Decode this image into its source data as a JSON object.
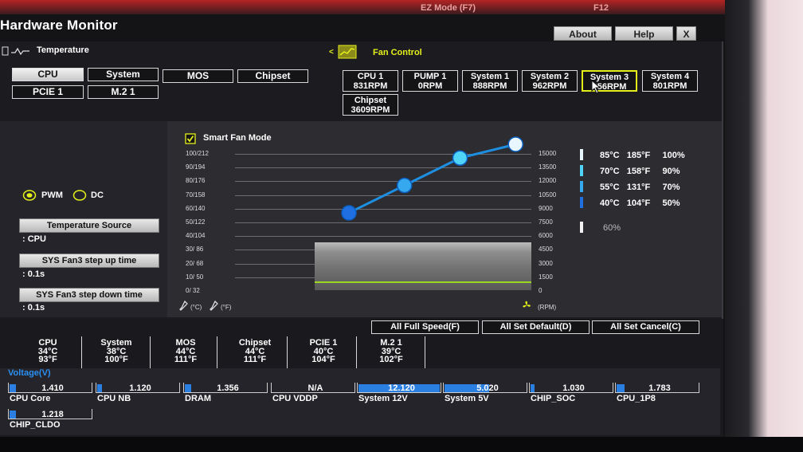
{
  "window": {
    "title": "Hardware Monitor",
    "top_buttons": {
      "about": "About",
      "help": "Help",
      "close": "X"
    }
  },
  "topbar": {
    "mode": "EZ Mode (F7)",
    "f12": "F12"
  },
  "tabs": {
    "temperature": "Temperature",
    "fan_control": "< Fan Control"
  },
  "temp_sources": [
    "CPU",
    "System",
    "MOS",
    "Chipset",
    "PCIE 1",
    "M.2 1"
  ],
  "fans": [
    {
      "name": "CPU 1",
      "rpm": "831RPM"
    },
    {
      "name": "PUMP 1",
      "rpm": "0RPM"
    },
    {
      "name": "System 1",
      "rpm": "888RPM"
    },
    {
      "name": "System 2",
      "rpm": "962RPM"
    },
    {
      "name": "System 3",
      "rpm": "856RPM"
    },
    {
      "name": "System 4",
      "rpm": "801RPM"
    },
    {
      "name": "Chipset",
      "rpm": "3609RPM"
    }
  ],
  "selected_fan": "System 3",
  "control": {
    "pwm": "PWM",
    "dc": "DC",
    "mode_selected": "PWM",
    "temp_source_label": "Temperature Source",
    "temp_source_value": ": CPU",
    "step_up_label": "SYS Fan3 step up time",
    "step_up_value": ": 0.1s",
    "step_down_label": "SYS Fan3 step down time",
    "step_down_value": ": 0.1s"
  },
  "graph": {
    "smart_fan_label": "Smart Fan Mode",
    "smart_fan_checked": true,
    "left_ticks": [
      "100/212",
      "90/194",
      "80/176",
      "70/158",
      "60/140",
      "50/122",
      "40/104",
      "30/ 86",
      "20/ 68",
      "10/ 50",
      "0/ 32"
    ],
    "right_ticks": [
      "15000",
      "13500",
      "12000",
      "10500",
      "9000",
      "7500",
      "6000",
      "4500",
      "3000",
      "1500",
      "0"
    ],
    "unit_left": "(°C)",
    "unit_f": "(°F)",
    "unit_right": "(RPM)",
    "curve_points": [
      {
        "temp_c": 40,
        "pct": 50
      },
      {
        "temp_c": 55,
        "pct": 70
      },
      {
        "temp_c": 70,
        "pct": 90
      },
      {
        "temp_c": 85,
        "pct": 100
      }
    ],
    "current_level": 0.35
  },
  "legend": [
    {
      "c": "85°C",
      "f": "185°F",
      "pct": "100%",
      "color": "#e8f6ff"
    },
    {
      "c": "70°C",
      "f": "158°F",
      "pct": "90%",
      "color": "#4fd3f7"
    },
    {
      "c": "55°C",
      "f": "131°F",
      "pct": "70%",
      "color": "#35a8ee"
    },
    {
      "c": "40°C",
      "f": "104°F",
      "pct": "50%",
      "color": "#1f6fe0"
    }
  ],
  "current_pct": "60%",
  "actions": {
    "full_speed": "All Full Speed(F)",
    "set_default": "All Set Default(D)",
    "set_cancel": "All Set Cancel(C)"
  },
  "temps": [
    {
      "name": "CPU",
      "c": "34°C",
      "f": "93°F"
    },
    {
      "name": "System",
      "c": "38°C",
      "f": "100°F"
    },
    {
      "name": "MOS",
      "c": "44°C",
      "f": "111°F"
    },
    {
      "name": "Chipset",
      "c": "44°C",
      "f": "111°F"
    },
    {
      "name": "PCIE 1",
      "c": "40°C",
      "f": "104°F"
    },
    {
      "name": "M.2 1",
      "c": "39°C",
      "f": "102°F"
    }
  ],
  "voltage_title": "Voltage(V)",
  "voltages": [
    {
      "name": "CPU Core",
      "value": "1.410",
      "fill": 0.08
    },
    {
      "name": "CPU NB",
      "value": "1.120",
      "fill": 0.06
    },
    {
      "name": "DRAM",
      "value": "1.356",
      "fill": 0.08
    },
    {
      "name": "CPU VDDP",
      "value": "N/A",
      "fill": 0
    },
    {
      "name": "System 12V",
      "value": "12.120",
      "fill": 1.0
    },
    {
      "name": "System 5V",
      "value": "5.020",
      "fill": 0.55
    },
    {
      "name": "CHIP_SOC",
      "value": "1.030",
      "fill": 0.05
    },
    {
      "name": "CPU_1P8",
      "value": "1.783",
      "fill": 0.1
    },
    {
      "name": "CHIP_CLDO",
      "value": "1.218",
      "fill": 0.08
    }
  ],
  "colors": {
    "accent_yellow": "#e4f01a",
    "curve": "#1e8fe0",
    "bar_blue": "#2b7fe0"
  }
}
